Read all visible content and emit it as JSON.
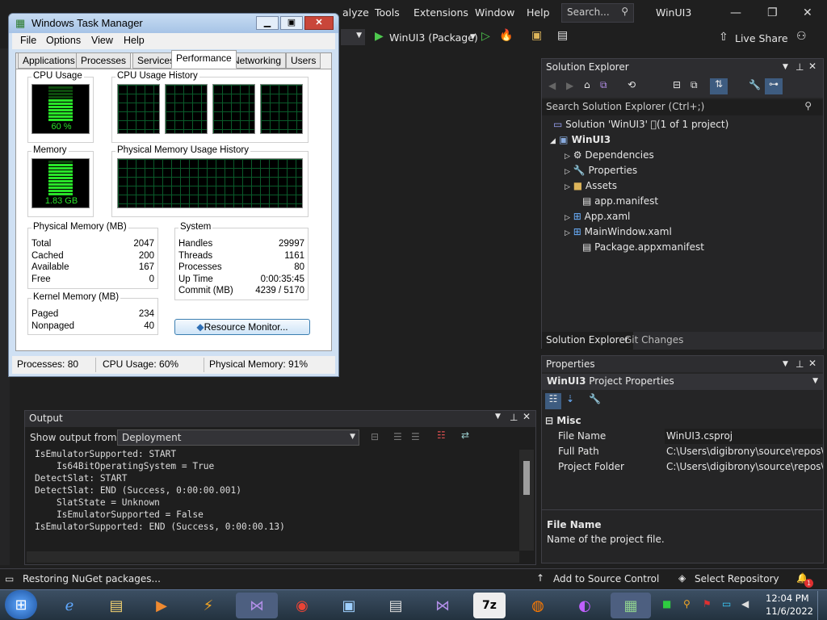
{
  "vs": {
    "menu": [
      "alyze",
      "Tools",
      "Extensions",
      "Window",
      "Help"
    ],
    "search_label": "Search...",
    "app_title": "WinUI3",
    "run_target": "WinUI3 (Package)",
    "live_share": "Live Share"
  },
  "task_manager": {
    "title": "Windows Task Manager",
    "menu": [
      "File",
      "Options",
      "View",
      "Help"
    ],
    "tabs": [
      "Applications",
      "Processes",
      "Services",
      "Performance",
      "Networking",
      "Users"
    ],
    "cpu_usage_label": "CPU Usage",
    "cpu_value": "60 %",
    "cpu_history_label": "CPU Usage History",
    "memory_label": "Memory",
    "memory_value": "1.83 GB",
    "mem_history_label": "Physical Memory Usage History",
    "physical_memory": {
      "label": "Physical Memory (MB)",
      "rows": [
        [
          "Total",
          "2047"
        ],
        [
          "Cached",
          "200"
        ],
        [
          "Available",
          "167"
        ],
        [
          "Free",
          "0"
        ]
      ]
    },
    "system": {
      "label": "System",
      "rows": [
        [
          "Handles",
          "29997"
        ],
        [
          "Threads",
          "1161"
        ],
        [
          "Processes",
          "80"
        ],
        [
          "Up Time",
          "0:00:35:45"
        ],
        [
          "Commit (MB)",
          "4239 / 5170"
        ]
      ]
    },
    "kernel_memory": {
      "label": "Kernel Memory (MB)",
      "rows": [
        [
          "Paged",
          "234"
        ],
        [
          "Nonpaged",
          "40"
        ]
      ]
    },
    "resource_monitor": "Resource Monitor...",
    "status": {
      "processes": "Processes: 80",
      "cpu": "CPU Usage: 60%",
      "memory": "Physical Memory: 91%"
    }
  },
  "output": {
    "title": "Output",
    "show_from_label": "Show output from:",
    "source": "Deployment",
    "text": "IsEmulatorSupported: START\n    Is64BitOperatingSystem = True\nDetectSlat: START\nDetectSlat: END (Success, 0:00:00.001)\n    SlatState = Unknown\n    IsEmulatorSupported = False\nIsEmulatorSupported: END (Success, 0:00:00.13)"
  },
  "solution_explorer": {
    "title": "Solution Explorer",
    "search_placeholder": "Search Solution Explorer (Ctrl+;)",
    "solution": "Solution 'WinUI3' \u0000(1 of 1 project)",
    "project": "WinUI3",
    "items": [
      "Dependencies",
      "Properties",
      "Assets",
      "app.manifest",
      "App.xaml",
      "MainWindow.xaml",
      "Package.appxmanifest"
    ],
    "tabs": [
      "Solution Explorer",
      "Git Changes"
    ]
  },
  "properties": {
    "title": "Properties",
    "object": "WinUI3",
    "object_type": "Project Properties",
    "category": "Misc",
    "rows": [
      [
        "File Name",
        "WinUI3.csproj"
      ],
      [
        "Full Path",
        "C:\\Users\\digibrony\\source\\repos\\Wi"
      ],
      [
        "Project Folder",
        "C:\\Users\\digibrony\\source\\repos\\Wi"
      ]
    ],
    "desc_title": "File Name",
    "desc_text": "Name of the project file."
  },
  "status_bar": {
    "message": "Restoring NuGet packages...",
    "source_control": "Add to Source Control",
    "repository": "Select Repository",
    "notifications": "1"
  },
  "taskbar": {
    "time": "12:04 PM",
    "date": "11/6/2022"
  },
  "colors": {
    "accent": "#6f3fc6",
    "meter_green": "#29e329"
  }
}
